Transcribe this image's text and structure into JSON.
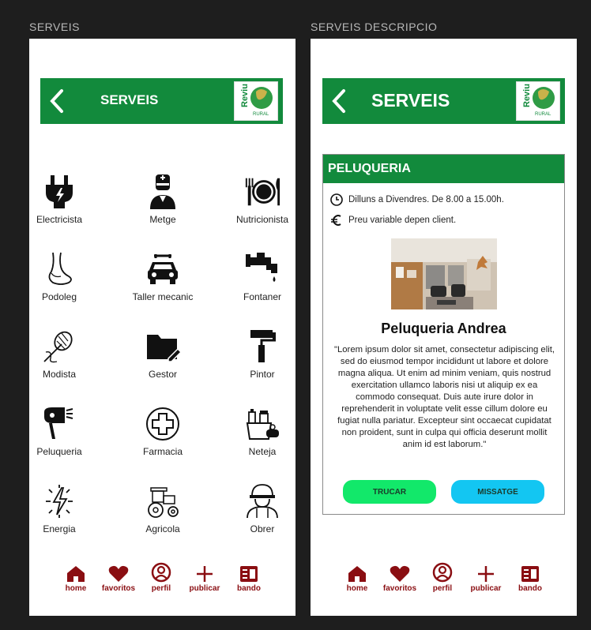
{
  "frames": {
    "left_title": "SERVEIS",
    "right_title": "SERVEIS DESCRIPCIO"
  },
  "header": {
    "title": "SERVEIS",
    "logo_text": "Reviu",
    "logo_subtext": "RURAL"
  },
  "services": [
    {
      "label": "Electricista",
      "icon": "plug-icon"
    },
    {
      "label": "Metge",
      "icon": "doctor-icon"
    },
    {
      "label": "Nutricionista",
      "icon": "plate-cutlery-icon"
    },
    {
      "label": "Podoleg",
      "icon": "foot-icon"
    },
    {
      "label": "Taller mecanic",
      "icon": "car-repair-icon"
    },
    {
      "label": "Fontaner",
      "icon": "faucet-icon"
    },
    {
      "label": "Modista",
      "icon": "sewing-icon"
    },
    {
      "label": "Gestor",
      "icon": "folder-edit-icon"
    },
    {
      "label": "Pintor",
      "icon": "paint-roller-icon"
    },
    {
      "label": "Peluqueria",
      "icon": "hair-dryer-icon"
    },
    {
      "label": "Farmacia",
      "icon": "pharmacy-cross-icon"
    },
    {
      "label": "Neteja",
      "icon": "cleaning-icon"
    },
    {
      "label": "Energia",
      "icon": "energy-icon"
    },
    {
      "label": "Agricola",
      "icon": "tractor-icon"
    },
    {
      "label": "Obrer",
      "icon": "worker-icon"
    }
  ],
  "nav": [
    {
      "label": "home",
      "icon": "home-icon"
    },
    {
      "label": "favoritos",
      "icon": "heart-icon"
    },
    {
      "label": "perfil",
      "icon": "profile-icon"
    },
    {
      "label": "publicar",
      "icon": "plus-icon"
    },
    {
      "label": "bando",
      "icon": "news-icon"
    }
  ],
  "detail": {
    "category": "PELUQUERIA",
    "schedule": "Dilluns a Divendres. De 8.00 a 15.00h.",
    "price": "Preu variable depen client.",
    "name": "Peluqueria Andrea",
    "description": "\"Lorem ipsum dolor sit amet, consectetur adipiscing elit, sed do eiusmod tempor incididunt ut labore et dolore magna aliqua. Ut enim ad minim veniam, quis nostrud exercitation ullamco laboris nisi ut aliquip ex ea commodo consequat. Duis aute irure dolor in reprehenderit in voluptate velit esse cillum dolore eu fugiat nulla pariatur. Excepteur sint occaecat cupidatat non proident, sunt in culpa qui officia deserunt mollit anim id est laborum.\"",
    "call_label": "TRUCAR",
    "message_label": "MISSATGE"
  },
  "colors": {
    "brand_green": "#128a3c",
    "nav_red": "#8a0e12",
    "call_green": "#12e86a",
    "message_blue": "#13c6f2"
  }
}
